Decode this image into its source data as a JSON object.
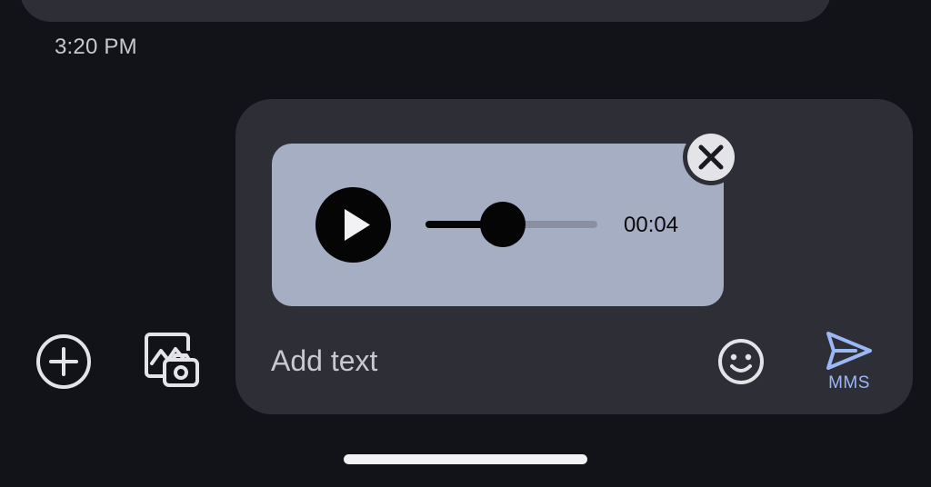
{
  "conversation": {
    "last_message_time": "3:20 PM"
  },
  "attachment": {
    "type": "audio",
    "duration": "00:04",
    "progress": 0.45
  },
  "composer": {
    "placeholder": "Add text",
    "send_label": "MMS"
  },
  "icons": {
    "add": "plus-circle-icon",
    "gallery_camera": "gallery-camera-icon",
    "emoji": "emoji-icon",
    "send": "send-icon",
    "play": "play-icon",
    "remove": "close-icon"
  },
  "colors": {
    "background": "#121318",
    "surface": "#2e2f36",
    "audio_card": "#a6aec4",
    "accent": "#9bb7f5",
    "icon": "#e3e3e8"
  }
}
